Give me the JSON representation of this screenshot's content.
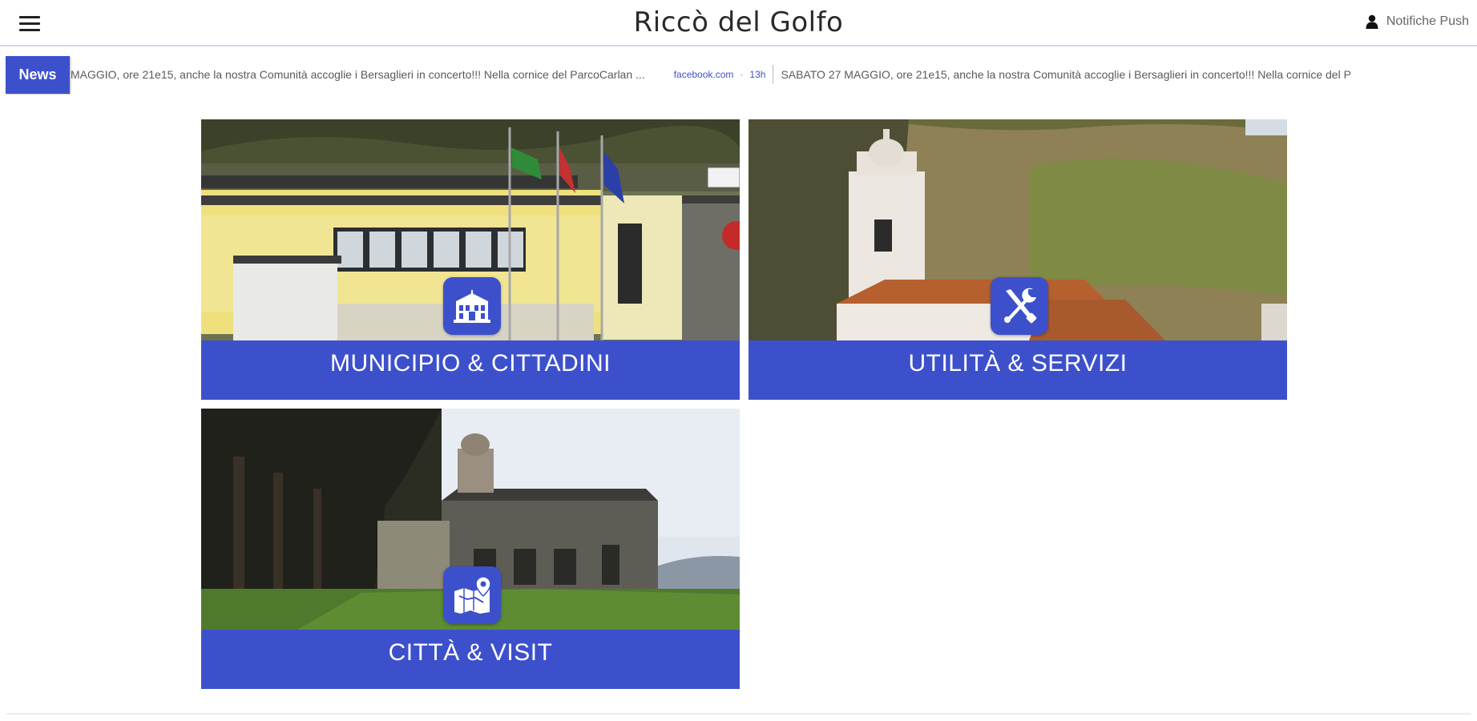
{
  "header": {
    "title": "Riccò del Golfo",
    "push_label": "Notifiche Push",
    "menu_icon": "hamburger-menu-icon",
    "push_icon": "person-icon"
  },
  "ticker": {
    "badge_label": "News",
    "item_1_text": "MAGGIO, ore 21e15, anche la nostra Comunità accoglie i Bersaglieri in concerto!!! Nella cornice del ParcoCarlan ...",
    "item_1_source": "facebook.com",
    "item_1_age": "13h",
    "item_2_text": "SABATO 27 MAGGIO, ore 21e15, anche la nostra Comunità accoglie i Bersaglieri in concerto!!! Nella cornice del P"
  },
  "tiles": [
    {
      "label": "MUNICIPIO & CITTADINI",
      "icon": "town-hall-icon"
    },
    {
      "label": "UTILITÀ & SERVIZI",
      "icon": "tools-icon"
    },
    {
      "label": "CITTÀ & VISIT",
      "icon": "map-pin-icon"
    }
  ],
  "colors": {
    "accent": "#3d50cc",
    "background": "#ffffff"
  }
}
